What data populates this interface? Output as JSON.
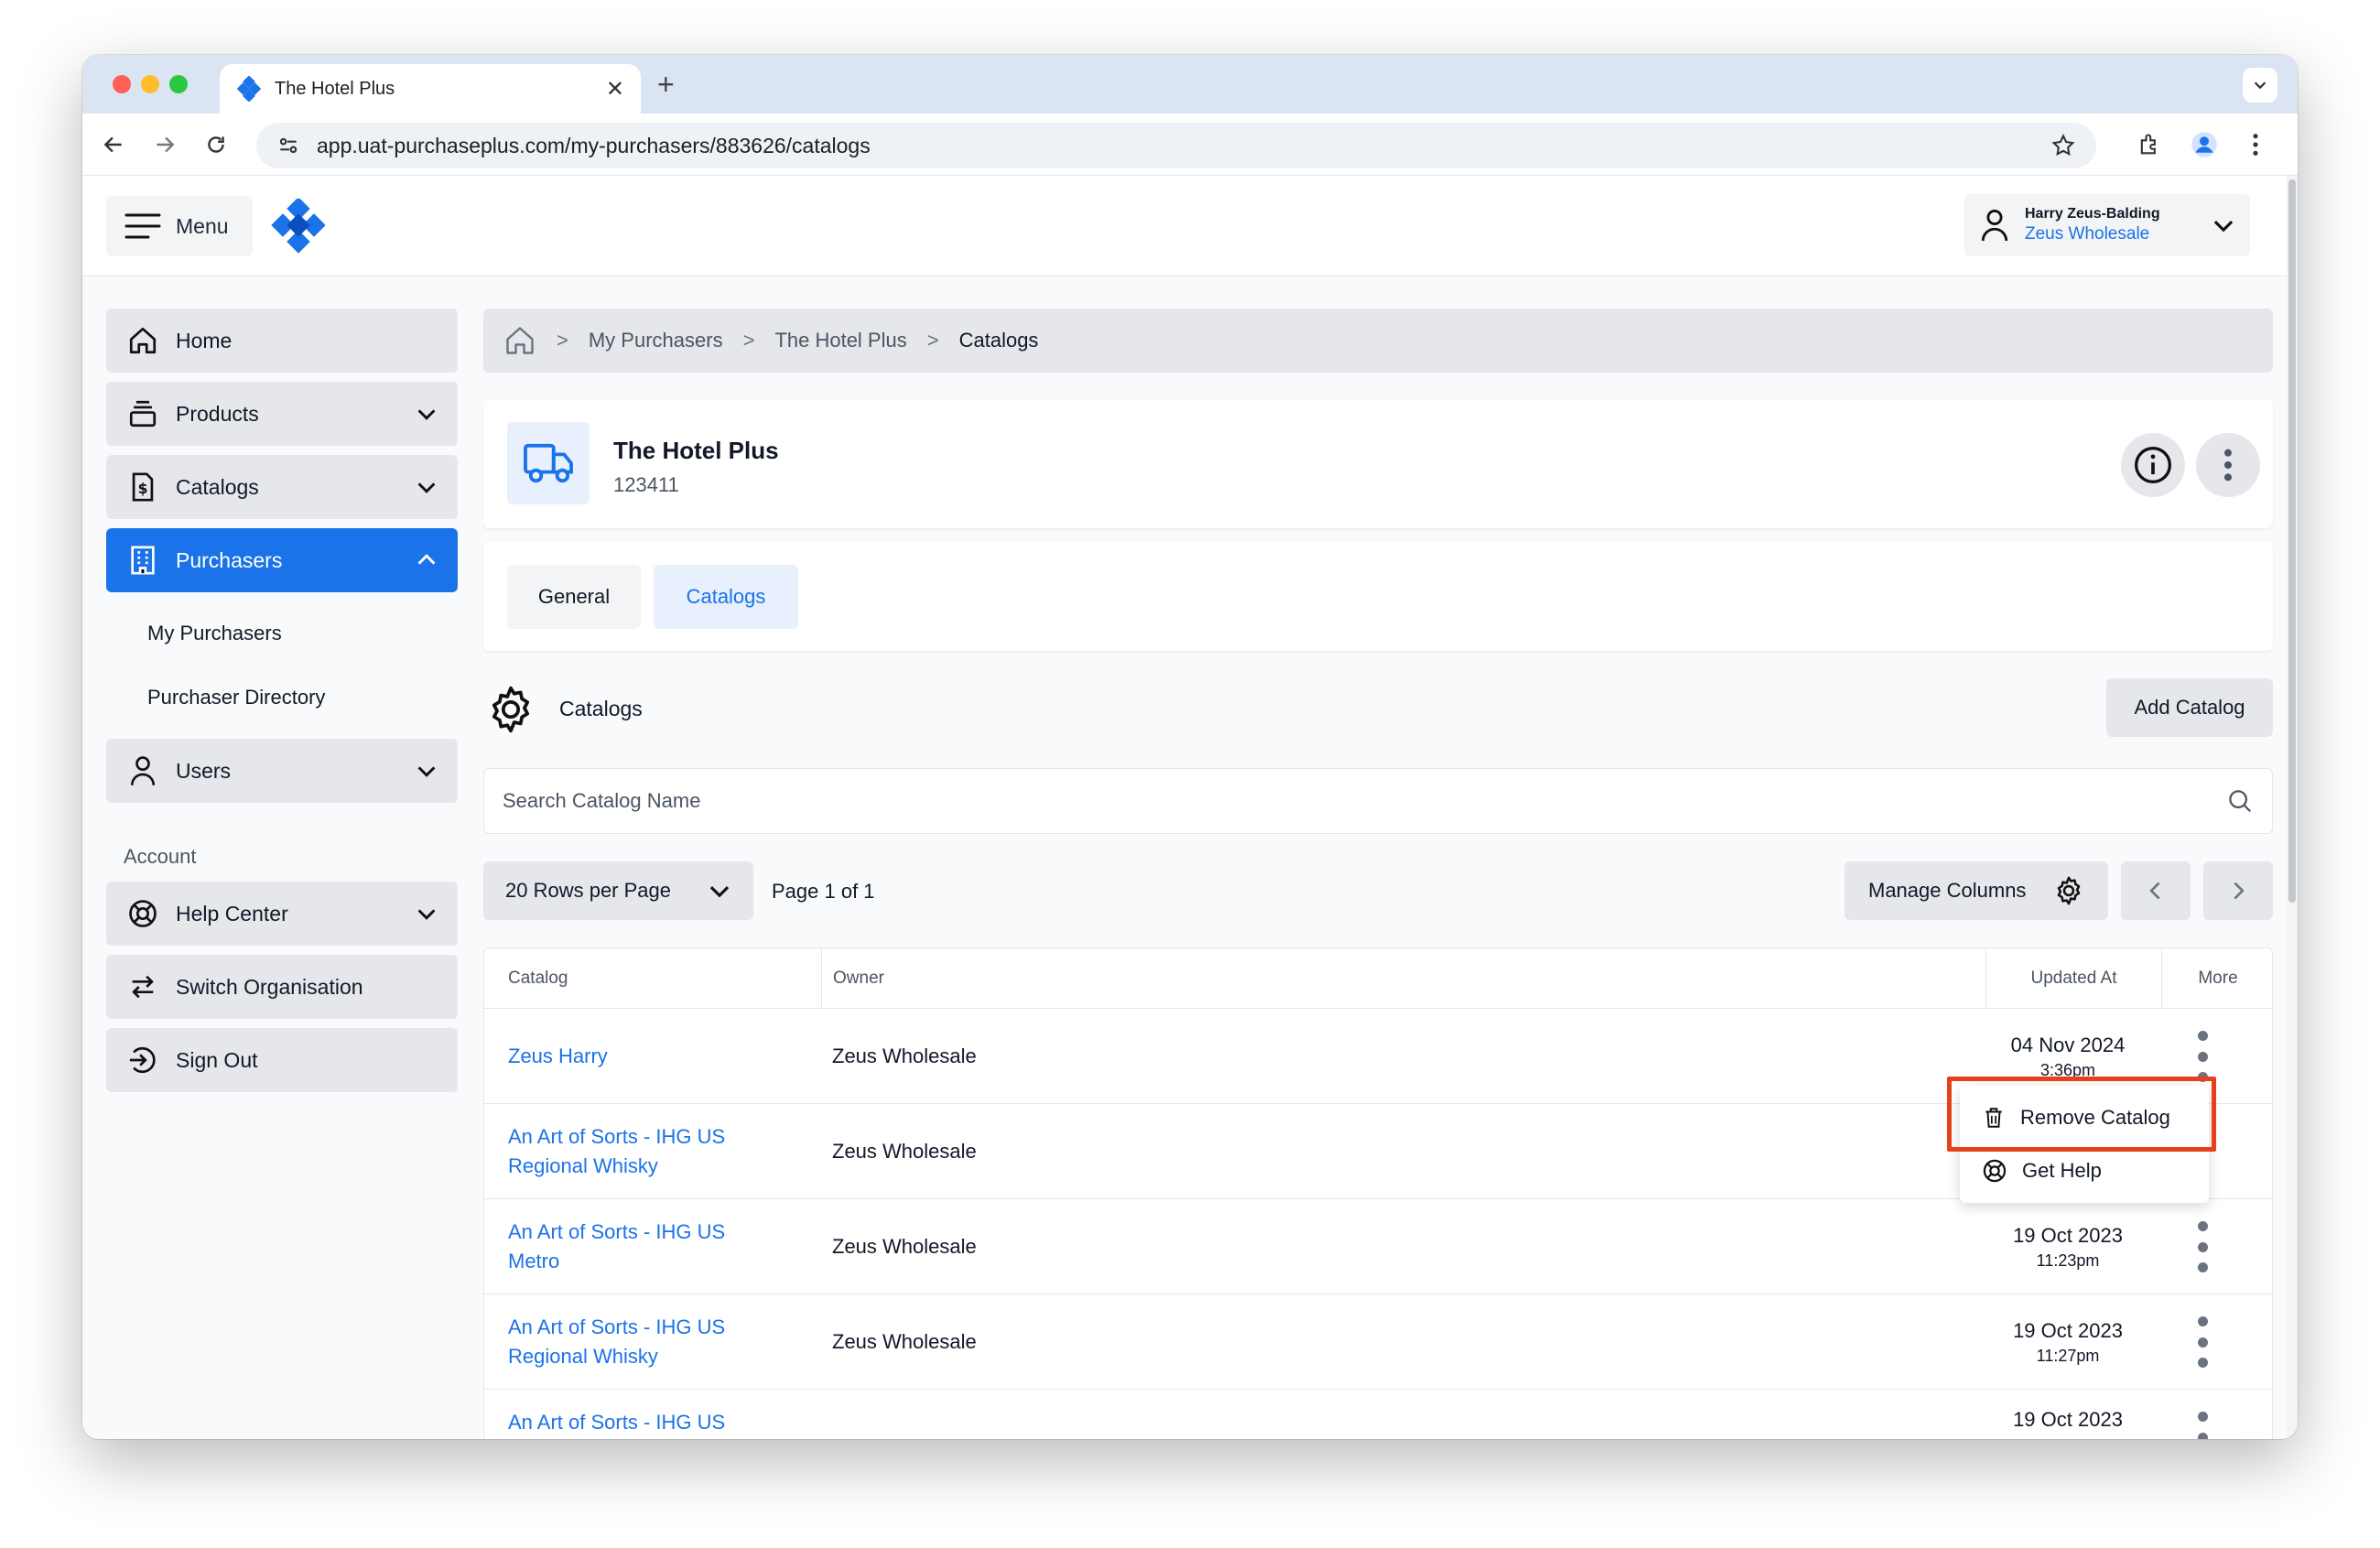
{
  "browser": {
    "tab_title": "The Hotel Plus",
    "url": "app.uat-purchaseplus.com/my-purchasers/883626/catalogs"
  },
  "header": {
    "menu_label": "Menu",
    "user_name": "Harry Zeus-Balding",
    "user_org": "Zeus Wholesale"
  },
  "sidebar": {
    "items": [
      {
        "label": "Home",
        "icon": "home-icon"
      },
      {
        "label": "Products",
        "icon": "products-icon"
      },
      {
        "label": "Catalogs",
        "icon": "catalogs-icon"
      },
      {
        "label": "Purchasers",
        "icon": "building-icon"
      },
      {
        "label": "Users",
        "icon": "user-icon"
      }
    ],
    "purchaser_sub": [
      "My Purchasers",
      "Purchaser Directory"
    ],
    "account_label": "Account",
    "account_items": [
      {
        "label": "Help Center",
        "icon": "lifebuoy-icon"
      },
      {
        "label": "Switch Organisation",
        "icon": "switch-icon"
      },
      {
        "label": "Sign Out",
        "icon": "sign-out-icon"
      }
    ]
  },
  "breadcrumb": {
    "items": [
      "My Purchasers",
      "The Hotel Plus",
      "Catalogs"
    ]
  },
  "supplier": {
    "name": "The Hotel Plus",
    "code": "123411"
  },
  "tabs": [
    "General",
    "Catalogs"
  ],
  "section": {
    "title": "Catalogs",
    "add_button": "Add Catalog"
  },
  "search": {
    "placeholder": "Search Catalog Name"
  },
  "pager": {
    "rows_per_page": "20 Rows per Page",
    "page_info": "Page 1 of 1",
    "manage_columns": "Manage Columns"
  },
  "table": {
    "headers": [
      "Catalog",
      "Owner",
      "Updated At",
      "More"
    ],
    "rows": [
      {
        "catalog": "Zeus Harry",
        "owner": "Zeus Wholesale",
        "date": "04 Nov 2024",
        "time": "3:36pm"
      },
      {
        "catalog": "An Art of Sorts - IHG US Regional Whisky",
        "owner": "Zeus Wholesale",
        "date": "",
        "time": ""
      },
      {
        "catalog": "An Art of Sorts - IHG US Metro",
        "owner": "Zeus Wholesale",
        "date": "19 Oct 2023",
        "time": "11:23pm"
      },
      {
        "catalog": "An Art of Sorts - IHG US Regional Whisky",
        "owner": "Zeus Wholesale",
        "date": "19 Oct 2023",
        "time": "11:27pm"
      },
      {
        "catalog": "An Art of Sorts - IHG US",
        "owner": "",
        "date": "19 Oct 2023",
        "time": ""
      }
    ]
  },
  "popup": {
    "remove": "Remove Catalog",
    "help": "Get Help"
  },
  "colors": {
    "accent": "#1a73e8",
    "highlight": "#e8401c"
  }
}
